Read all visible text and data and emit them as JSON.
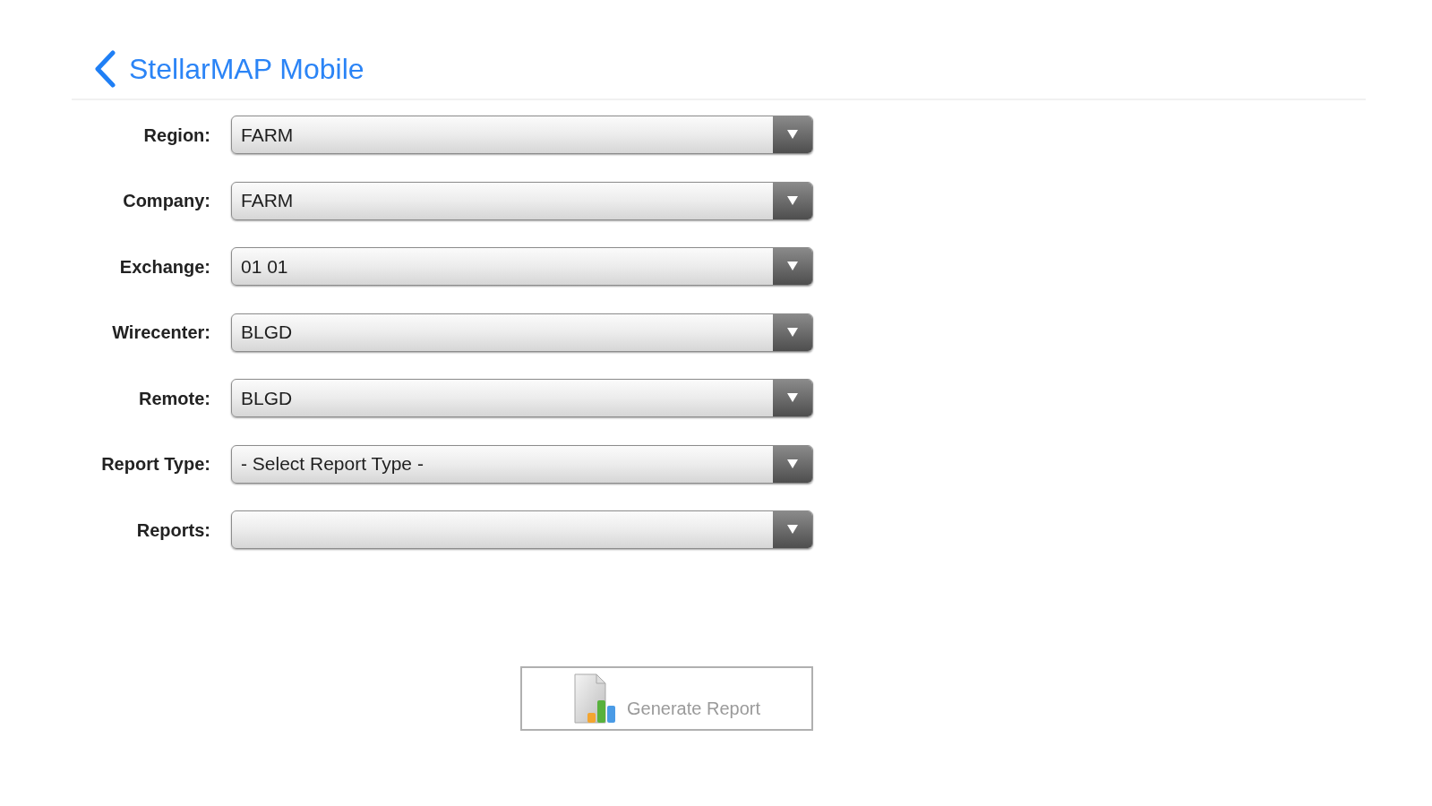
{
  "header": {
    "title": "StellarMAP Mobile"
  },
  "form": {
    "fields": [
      {
        "label": "Region:",
        "value": "FARM"
      },
      {
        "label": "Company:",
        "value": "FARM"
      },
      {
        "label": "Exchange:",
        "value": "01 01"
      },
      {
        "label": "Wirecenter:",
        "value": "BLGD"
      },
      {
        "label": "Remote:",
        "value": "BLGD"
      },
      {
        "label": "Report Type:",
        "value": "- Select Report Type -"
      },
      {
        "label": "Reports:"
      }
    ]
  },
  "generate_button": {
    "label": "Generate Report",
    "disabled": true
  }
}
